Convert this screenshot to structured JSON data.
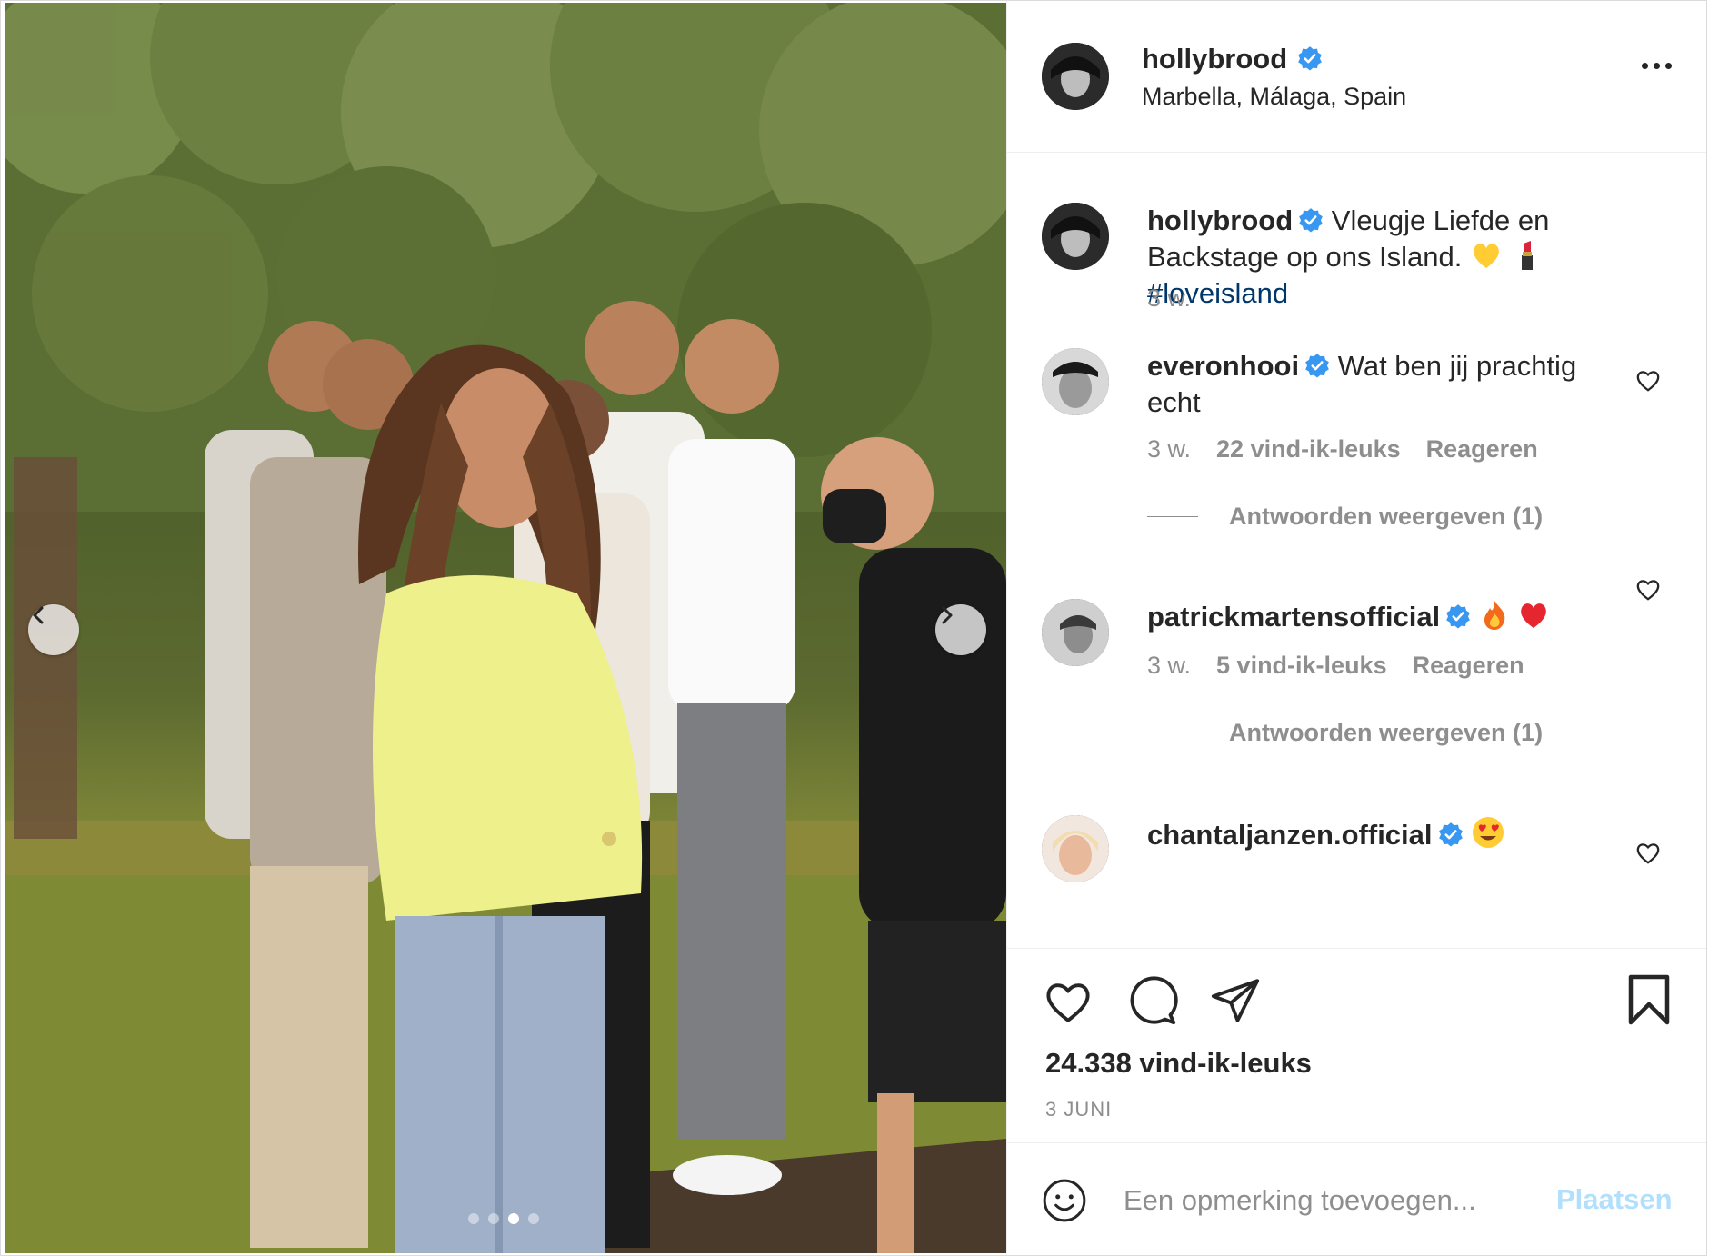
{
  "post": {
    "author": {
      "username": "hollybrood",
      "verified": true,
      "location": "Marbella, Málaga, Spain"
    },
    "caption": {
      "username": "hollybrood",
      "text": "Vleugje Liefde en Backstage op ons Island.",
      "emojis": [
        "yellow-heart",
        "lipstick"
      ],
      "hashtag": "#loveisland",
      "time": "3 w."
    },
    "carousel": {
      "total_slides": 4,
      "active_slide": 3
    },
    "comments": [
      {
        "username": "everonhooi",
        "verified": true,
        "text": "Wat ben jij prachtig echt",
        "time": "3 w.",
        "likes": "22 vind-ik-leuks",
        "reply_label": "Reageren",
        "view_replies": "Antwoorden weergeven (1)"
      },
      {
        "username": "patrickmartensofficial",
        "verified": true,
        "text": "",
        "emojis": [
          "fire",
          "red-heart"
        ],
        "time": "3 w.",
        "likes": "5 vind-ik-leuks",
        "reply_label": "Reageren",
        "view_replies": "Antwoorden weergeven (1)"
      },
      {
        "username": "chantaljanzen.official",
        "verified": true,
        "text": "",
        "emojis": [
          "heart-eyes"
        ]
      }
    ],
    "likes": "24.338 vind-ik-leuks",
    "date": "3 JUNI",
    "add_comment": {
      "placeholder": "Een opmerking toevoegen...",
      "post_label": "Plaatsen"
    }
  },
  "colors": {
    "verified": "#3897f0",
    "link": "#00376b",
    "muted": "#8e8e8e",
    "post_disabled": "#b2dffc"
  }
}
